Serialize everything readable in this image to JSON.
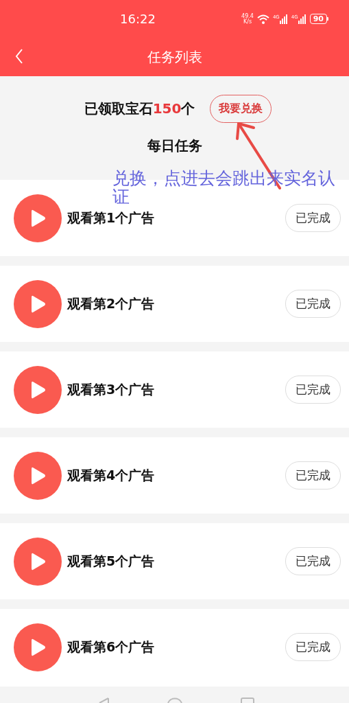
{
  "status_bar": {
    "time": "16:22",
    "speed_value": "49.4",
    "speed_unit": "K/s",
    "networks": [
      "4G",
      "4G"
    ],
    "battery": "90"
  },
  "header": {
    "title": "任务列表"
  },
  "gems": {
    "label_prefix": "已领取宝石",
    "count": "150",
    "label_suffix": "个",
    "button": "我要兑换"
  },
  "section_title": "每日任务",
  "annotation": {
    "text": "兑换，点进去会跳出来实名认证"
  },
  "tasks": [
    {
      "title": "观看第1个广告",
      "button": "已完成",
      "done": true
    },
    {
      "title": "观看第2个广告",
      "button": "已完成",
      "done": true
    },
    {
      "title": "观看第3个广告",
      "button": "已完成",
      "done": true
    },
    {
      "title": "观看第4个广告",
      "button": "已完成",
      "done": true
    },
    {
      "title": "观看第5个广告",
      "button": "已完成",
      "done": true
    },
    {
      "title": "观看第6个广告",
      "button": "已完成",
      "done": true
    }
  ]
}
